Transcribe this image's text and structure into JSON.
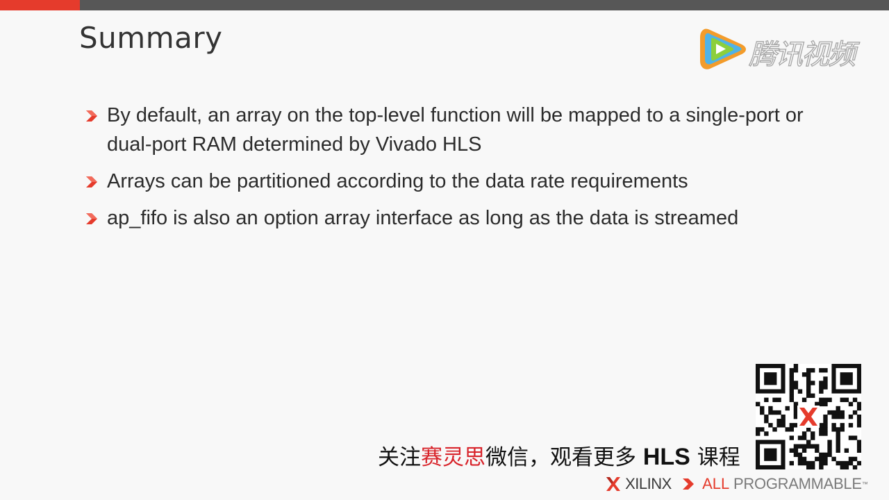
{
  "slide": {
    "title": "Summary",
    "bullets": [
      "By default, an array on the top-level function will be mapped to a single-port or dual-port RAM determined by Vivado HLS",
      "Arrays can be partitioned according to the data rate requirements",
      "ap_fifo is also an option array interface as long as the data is streamed"
    ]
  },
  "watermark": {
    "text": "腾讯视频",
    "icon": "tencent-video-play-icon"
  },
  "promo": {
    "part1": "关注",
    "part2_red": "赛灵思",
    "part3": "微信，观看更多 ",
    "part4_bold": "HLS",
    "part5": " 课程"
  },
  "footer": {
    "brand": "XILINX",
    "tagline_all": "ALL",
    "tagline_rest": " PROGRAMMABLE",
    "trademark": "™"
  },
  "colors": {
    "accent": "#e53b2c",
    "topbar": "#575757",
    "text": "#2b2b2b"
  }
}
